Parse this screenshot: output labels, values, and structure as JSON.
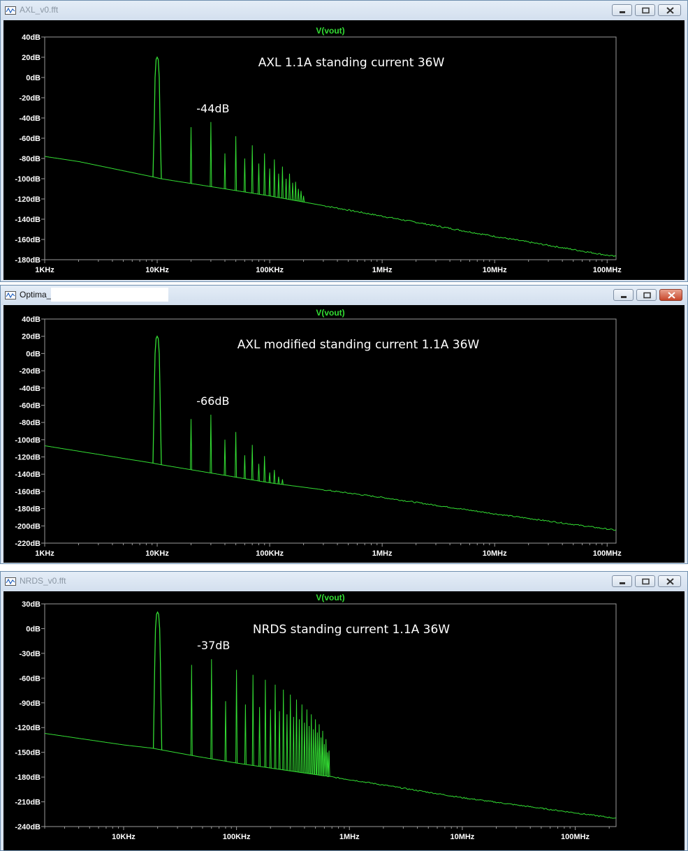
{
  "windows": [
    {
      "title": "AXL_v0.fft",
      "active": false,
      "trace_label": "V(vout)",
      "annotation": "AXL 1.1A standing current 36W",
      "harmonic_label": "-44dB",
      "colors": {
        "trace": "#33dd33",
        "title": "#33dd33",
        "tick": "#ffffff",
        "frame": "#9a9a9a"
      }
    },
    {
      "title": "Optima_",
      "active": true,
      "trace_label": "V(vout)",
      "annotation": "AXL modified standing current 1.1A 36W",
      "harmonic_label": "-66dB",
      "colors": {
        "trace": "#33dd33",
        "title": "#33dd33",
        "tick": "#ffffff",
        "frame": "#9a9a9a"
      }
    },
    {
      "title": "NRDS_v0.fft",
      "active": false,
      "trace_label": "V(vout)",
      "annotation": "NRDS standing current 1.1A 36W",
      "harmonic_label": "-37dB",
      "colors": {
        "trace": "#33dd33",
        "title": "#33dd33",
        "tick": "#ffffff",
        "frame": "#9a9a9a"
      }
    }
  ],
  "chart_data": [
    {
      "type": "line",
      "title": "V(vout)",
      "x_scale": "log",
      "xlim": [
        1000,
        120000000
      ],
      "ylim": [
        -180,
        40
      ],
      "x_ticks": [
        {
          "value": 1000,
          "label": "1KHz"
        },
        {
          "value": 10000,
          "label": "10KHz"
        },
        {
          "value": 100000,
          "label": "100KHz"
        },
        {
          "value": 1000000,
          "label": "1MHz"
        },
        {
          "value": 10000000,
          "label": "10MHz"
        },
        {
          "value": 100000000,
          "label": "100MHz"
        }
      ],
      "y_ticks": [
        {
          "value": 40,
          "label": "40dB"
        },
        {
          "value": 20,
          "label": "20dB"
        },
        {
          "value": 0,
          "label": "0dB"
        },
        {
          "value": -20,
          "label": "-20dB"
        },
        {
          "value": -40,
          "label": "-40dB"
        },
        {
          "value": -60,
          "label": "-60dB"
        },
        {
          "value": -80,
          "label": "-80dB"
        },
        {
          "value": -100,
          "label": "-100dB"
        },
        {
          "value": -120,
          "label": "-120dB"
        },
        {
          "value": -140,
          "label": "-140dB"
        },
        {
          "value": -160,
          "label": "-160dB"
        },
        {
          "value": -180,
          "label": "-180dB"
        }
      ],
      "fundamental": {
        "freq": 10000,
        "db": 20
      },
      "harmonics": [
        {
          "n": 2,
          "db": -49
        },
        {
          "n": 3,
          "db": -44
        },
        {
          "n": 4,
          "db": -75
        },
        {
          "n": 5,
          "db": -58
        },
        {
          "n": 6,
          "db": -80
        },
        {
          "n": 7,
          "db": -67
        },
        {
          "n": 8,
          "db": -85
        },
        {
          "n": 9,
          "db": -75
        },
        {
          "n": 10,
          "db": -90
        },
        {
          "n": 11,
          "db": -81
        },
        {
          "n": 12,
          "db": -95
        },
        {
          "n": 13,
          "db": -88
        },
        {
          "n": 14,
          "db": -100
        },
        {
          "n": 15,
          "db": -95
        },
        {
          "n": 16,
          "db": -104
        },
        {
          "n": 17,
          "db": -103
        },
        {
          "n": 18,
          "db": -110
        },
        {
          "n": 19,
          "db": -112
        },
        {
          "n": 20,
          "db": -117
        }
      ],
      "noise_floor": [
        {
          "x": 1000,
          "y": -78
        },
        {
          "x": 2000,
          "y": -83
        },
        {
          "x": 9000,
          "y": -98
        },
        {
          "x": 10800,
          "y": -100
        },
        {
          "x": 100000,
          "y": -117
        },
        {
          "x": 1000000,
          "y": -137
        },
        {
          "x": 10000000,
          "y": -157
        },
        {
          "x": 120000000,
          "y": -177
        }
      ]
    },
    {
      "type": "line",
      "title": "V(vout)",
      "x_scale": "log",
      "xlim": [
        1000,
        120000000
      ],
      "ylim": [
        -220,
        40
      ],
      "x_ticks": [
        {
          "value": 1000,
          "label": "1KHz"
        },
        {
          "value": 10000,
          "label": "10KHz"
        },
        {
          "value": 100000,
          "label": "100KHz"
        },
        {
          "value": 1000000,
          "label": "1MHz"
        },
        {
          "value": 10000000,
          "label": "10MHz"
        },
        {
          "value": 100000000,
          "label": "100MHz"
        }
      ],
      "y_ticks": [
        {
          "value": 40,
          "label": "40dB"
        },
        {
          "value": 20,
          "label": "20dB"
        },
        {
          "value": 0,
          "label": "0dB"
        },
        {
          "value": -20,
          "label": "-20dB"
        },
        {
          "value": -40,
          "label": "-40dB"
        },
        {
          "value": -60,
          "label": "-60dB"
        },
        {
          "value": -80,
          "label": "-80dB"
        },
        {
          "value": -100,
          "label": "-100dB"
        },
        {
          "value": -120,
          "label": "-120dB"
        },
        {
          "value": -140,
          "label": "-140dB"
        },
        {
          "value": -160,
          "label": "-160dB"
        },
        {
          "value": -180,
          "label": "-180dB"
        },
        {
          "value": -200,
          "label": "-200dB"
        },
        {
          "value": -220,
          "label": "-220dB"
        }
      ],
      "fundamental": {
        "freq": 10000,
        "db": 20
      },
      "harmonics": [
        {
          "n": 2,
          "db": -76
        },
        {
          "n": 3,
          "db": -71
        },
        {
          "n": 4,
          "db": -100
        },
        {
          "n": 5,
          "db": -91
        },
        {
          "n": 6,
          "db": -118
        },
        {
          "n": 7,
          "db": -106
        },
        {
          "n": 8,
          "db": -128
        },
        {
          "n": 9,
          "db": -119
        },
        {
          "n": 10,
          "db": -138
        },
        {
          "n": 11,
          "db": -135
        },
        {
          "n": 12,
          "db": -143
        },
        {
          "n": 13,
          "db": -146
        }
      ],
      "noise_floor": [
        {
          "x": 1000,
          "y": -107
        },
        {
          "x": 9000,
          "y": -127
        },
        {
          "x": 10800,
          "y": -129
        },
        {
          "x": 100000,
          "y": -150
        },
        {
          "x": 1000000,
          "y": -167
        },
        {
          "x": 10000000,
          "y": -186
        },
        {
          "x": 120000000,
          "y": -205
        }
      ]
    },
    {
      "type": "line",
      "title": "V(vout)",
      "x_scale": "log",
      "xlim": [
        2000,
        230000000
      ],
      "ylim": [
        -240,
        30
      ],
      "x_ticks": [
        {
          "value": 10000,
          "label": "10KHz"
        },
        {
          "value": 100000,
          "label": "100KHz"
        },
        {
          "value": 1000000,
          "label": "1MHz"
        },
        {
          "value": 10000000,
          "label": "10MHz"
        },
        {
          "value": 100000000,
          "label": "100MHz"
        }
      ],
      "y_ticks": [
        {
          "value": 30,
          "label": "30dB"
        },
        {
          "value": 0,
          "label": "0dB"
        },
        {
          "value": -30,
          "label": "-30dB"
        },
        {
          "value": -60,
          "label": "-60dB"
        },
        {
          "value": -90,
          "label": "-90dB"
        },
        {
          "value": -120,
          "label": "-120dB"
        },
        {
          "value": -150,
          "label": "-150dB"
        },
        {
          "value": -180,
          "label": "-180dB"
        },
        {
          "value": -210,
          "label": "-210dB"
        },
        {
          "value": -240,
          "label": "-240dB"
        }
      ],
      "fundamental": {
        "freq": 20000,
        "db": 20
      },
      "harmonics": [
        {
          "n": 2,
          "db": -44
        },
        {
          "n": 3,
          "db": -37
        },
        {
          "n": 4,
          "db": -88
        },
        {
          "n": 5,
          "db": -50
        },
        {
          "n": 6,
          "db": -92
        },
        {
          "n": 7,
          "db": -56
        },
        {
          "n": 8,
          "db": -95
        },
        {
          "n": 9,
          "db": -62
        },
        {
          "n": 10,
          "db": -98
        },
        {
          "n": 11,
          "db": -68
        },
        {
          "n": 12,
          "db": -100
        },
        {
          "n": 13,
          "db": -74
        },
        {
          "n": 14,
          "db": -104
        },
        {
          "n": 15,
          "db": -80
        },
        {
          "n": 16,
          "db": -107
        },
        {
          "n": 17,
          "db": -86
        },
        {
          "n": 18,
          "db": -110
        },
        {
          "n": 19,
          "db": -92
        },
        {
          "n": 20,
          "db": -114
        },
        {
          "n": 21,
          "db": -98
        },
        {
          "n": 22,
          "db": -118
        },
        {
          "n": 23,
          "db": -104
        },
        {
          "n": 24,
          "db": -122
        },
        {
          "n": 25,
          "db": -110
        },
        {
          "n": 26,
          "db": -126
        },
        {
          "n": 27,
          "db": -116
        },
        {
          "n": 28,
          "db": -132
        },
        {
          "n": 29,
          "db": -124
        },
        {
          "n": 30,
          "db": -140
        },
        {
          "n": 31,
          "db": -134
        },
        {
          "n": 32,
          "db": -150
        },
        {
          "n": 33,
          "db": -148
        }
      ],
      "noise_floor": [
        {
          "x": 2000,
          "y": -127
        },
        {
          "x": 10000,
          "y": -141
        },
        {
          "x": 18000,
          "y": -145
        },
        {
          "x": 45000,
          "y": -155
        },
        {
          "x": 100000,
          "y": -163
        },
        {
          "x": 1000000,
          "y": -183
        },
        {
          "x": 10000000,
          "y": -205
        },
        {
          "x": 230000000,
          "y": -230
        }
      ]
    }
  ]
}
